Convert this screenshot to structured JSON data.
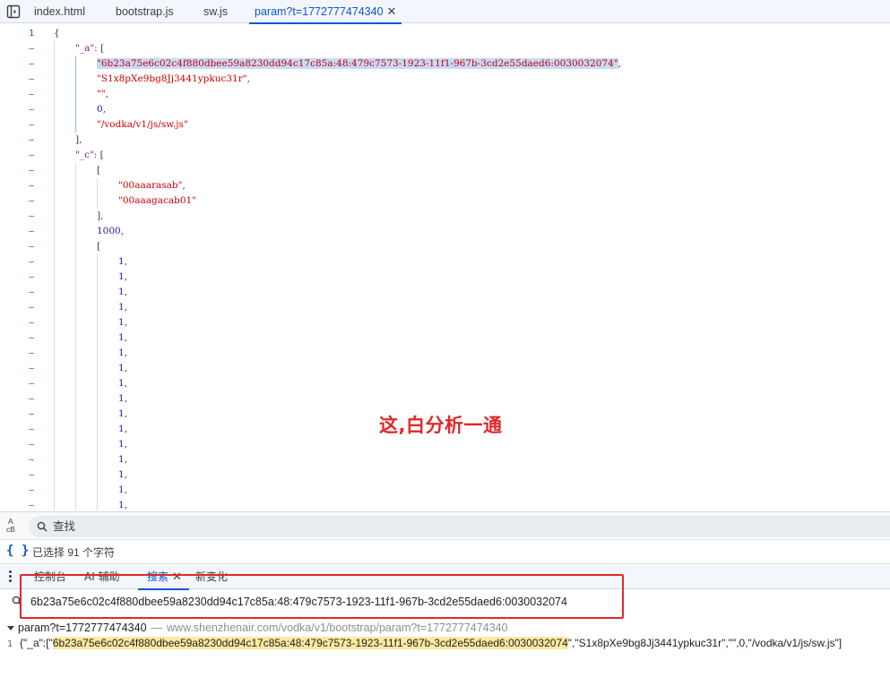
{
  "tabs": [
    {
      "label": "index.html",
      "active": false
    },
    {
      "label": "bootstrap.js",
      "active": false
    },
    {
      "label": "sw.js",
      "active": false
    },
    {
      "label": "param?t=1772777474340",
      "active": true
    }
  ],
  "tab_close_glyph": "✕",
  "editor": {
    "first_line_number": "1",
    "fold_marker": "–",
    "lines": [
      {
        "indent": 0,
        "parts": [
          {
            "t": "{",
            "c": "punc"
          }
        ]
      },
      {
        "indent": 1,
        "parts": [
          {
            "t": "\"_a\"",
            "c": "key"
          },
          {
            "t": ": [",
            "c": "punc"
          }
        ]
      },
      {
        "indent": 2,
        "parts": [
          {
            "t": "\"6b23a75e6c02c4f880dbee59a8230dd94c17c85a:48:479c7573-1923-11f1-967b-3cd2e55daed6:0030032074\"",
            "c": "str",
            "sel": true
          },
          {
            "t": ",",
            "c": "punc"
          }
        ]
      },
      {
        "indent": 2,
        "parts": [
          {
            "t": "\"S1x8pXe9bg8Jj3441ypkuc31r\"",
            "c": "str"
          },
          {
            "t": ",",
            "c": "punc"
          }
        ]
      },
      {
        "indent": 2,
        "parts": [
          {
            "t": "\"\"",
            "c": "str"
          },
          {
            "t": ",",
            "c": "punc"
          }
        ]
      },
      {
        "indent": 2,
        "parts": [
          {
            "t": "0",
            "c": "num"
          },
          {
            "t": ",",
            "c": "punc"
          }
        ]
      },
      {
        "indent": 2,
        "parts": [
          {
            "t": "\"/vodka/v1/js/sw.js\"",
            "c": "str"
          }
        ]
      },
      {
        "indent": 1,
        "parts": [
          {
            "t": "],",
            "c": "punc"
          }
        ]
      },
      {
        "indent": 1,
        "parts": [
          {
            "t": "\"_c\"",
            "c": "key"
          },
          {
            "t": ": [",
            "c": "punc"
          }
        ]
      },
      {
        "indent": 2,
        "parts": [
          {
            "t": "[",
            "c": "punc"
          }
        ]
      },
      {
        "indent": 3,
        "parts": [
          {
            "t": "\"00aaarasab\"",
            "c": "str"
          },
          {
            "t": ",",
            "c": "punc"
          }
        ]
      },
      {
        "indent": 3,
        "parts": [
          {
            "t": "\"00aaagacab01\"",
            "c": "str"
          }
        ]
      },
      {
        "indent": 2,
        "parts": [
          {
            "t": "],",
            "c": "punc"
          }
        ]
      },
      {
        "indent": 2,
        "parts": [
          {
            "t": "1000",
            "c": "num"
          },
          {
            "t": ",",
            "c": "punc"
          }
        ]
      },
      {
        "indent": 2,
        "parts": [
          {
            "t": "[",
            "c": "punc"
          }
        ]
      },
      {
        "indent": 3,
        "parts": [
          {
            "t": "1",
            "c": "num"
          },
          {
            "t": ",",
            "c": "punc"
          }
        ]
      },
      {
        "indent": 3,
        "parts": [
          {
            "t": "1",
            "c": "num"
          },
          {
            "t": ",",
            "c": "punc"
          }
        ]
      },
      {
        "indent": 3,
        "parts": [
          {
            "t": "1",
            "c": "num"
          },
          {
            "t": ",",
            "c": "punc"
          }
        ]
      },
      {
        "indent": 3,
        "parts": [
          {
            "t": "1",
            "c": "num"
          },
          {
            "t": ",",
            "c": "punc"
          }
        ]
      },
      {
        "indent": 3,
        "parts": [
          {
            "t": "1",
            "c": "num"
          },
          {
            "t": ",",
            "c": "punc"
          }
        ]
      },
      {
        "indent": 3,
        "parts": [
          {
            "t": "1",
            "c": "num"
          },
          {
            "t": ",",
            "c": "punc"
          }
        ]
      },
      {
        "indent": 3,
        "parts": [
          {
            "t": "1",
            "c": "num"
          },
          {
            "t": ",",
            "c": "punc"
          }
        ]
      },
      {
        "indent": 3,
        "parts": [
          {
            "t": "1",
            "c": "num"
          },
          {
            "t": ",",
            "c": "punc"
          }
        ]
      },
      {
        "indent": 3,
        "parts": [
          {
            "t": "1",
            "c": "num"
          },
          {
            "t": ",",
            "c": "punc"
          }
        ]
      },
      {
        "indent": 3,
        "parts": [
          {
            "t": "1",
            "c": "num"
          },
          {
            "t": ",",
            "c": "punc"
          }
        ]
      },
      {
        "indent": 3,
        "parts": [
          {
            "t": "1",
            "c": "num"
          },
          {
            "t": ",",
            "c": "punc"
          }
        ]
      },
      {
        "indent": 3,
        "parts": [
          {
            "t": "1",
            "c": "num"
          },
          {
            "t": ",",
            "c": "punc"
          }
        ]
      },
      {
        "indent": 3,
        "parts": [
          {
            "t": "1",
            "c": "num"
          },
          {
            "t": ",",
            "c": "punc"
          }
        ]
      },
      {
        "indent": 3,
        "parts": [
          {
            "t": "1",
            "c": "num"
          },
          {
            "t": ",",
            "c": "punc"
          }
        ]
      },
      {
        "indent": 3,
        "parts": [
          {
            "t": "1",
            "c": "num"
          },
          {
            "t": ",",
            "c": "punc"
          }
        ]
      },
      {
        "indent": 3,
        "parts": [
          {
            "t": "1",
            "c": "num"
          },
          {
            "t": ",",
            "c": "punc"
          }
        ]
      },
      {
        "indent": 3,
        "parts": [
          {
            "t": "1",
            "c": "num"
          },
          {
            "t": ",",
            "c": "punc"
          }
        ]
      }
    ]
  },
  "annotation": "这,白分析一通",
  "find_bar": {
    "case_toggle_top": "A",
    "case_toggle_bottom": "cB",
    "placeholder": "查找"
  },
  "status": {
    "icon_glyph": "{ }",
    "text": "已选择 91 个字符"
  },
  "drawer": {
    "tabs": [
      {
        "label": "控制台",
        "active": false
      },
      {
        "label": "AI 辅助",
        "active": false
      },
      {
        "label": "搜索",
        "active": true
      },
      {
        "label": "新变化",
        "active": false
      }
    ],
    "close_glyph": "✕",
    "search_query": "6b23a75e6c02c4f880dbee59a8230dd94c17c85a:48:479c7573-1923-11f1-967b-3cd2e55daed6:0030032074",
    "result": {
      "file": "param?t=1772777474340",
      "separator": "—",
      "url": "www.shenzhenair.com/vodka/v1/bootstrap/param?t=1772777474340",
      "line_number": "1",
      "prefix": "{\"_a\":[\"",
      "match": "6b23a75e6c02c4f880dbee59a8230dd94c17c85a:48:479c7573-1923-11f1-967b-3cd2e55daed6:0030032074",
      "suffix": "\",\"S1x8pXe9bg8Jj3441ypkuc31r\",\"\",0,\"/vodka/v1/js/sw.js\"]"
    }
  },
  "colors": {
    "accent": "#0b57d0",
    "annotation_red": "#e0282b",
    "string": "#c80000",
    "key": "#881280",
    "number": "#1a1aa6",
    "match_highlight": "#fde9a0",
    "selection": "#c8daf8"
  },
  "icons": [
    "sidebar-toggle-icon",
    "search-icon",
    "braces-icon",
    "kebab-menu-icon",
    "caret-down-icon",
    "close-icon"
  ]
}
